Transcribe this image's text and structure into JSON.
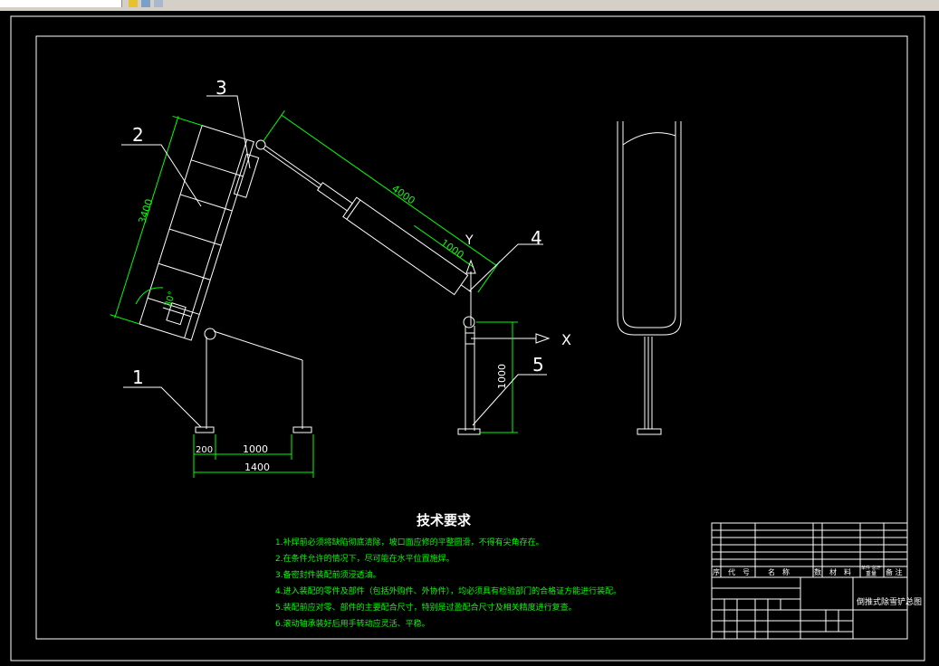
{
  "dimensions": {
    "d3400": "3400",
    "d4000": "4000",
    "d1000_cyl": "1000",
    "d30": "30°",
    "d1000_post": "1000",
    "d200": "200",
    "d1000_base": "1000",
    "d1400": "1400"
  },
  "part_labels": {
    "p1": "1",
    "p2": "2",
    "p3": "3",
    "p4": "4",
    "p5": "5"
  },
  "axes": {
    "x": "X",
    "y": "Y"
  },
  "tech": {
    "title": "技术要求",
    "items": [
      "1.补焊前必须将缺陷彻底清除，坡口面应修的平整圆滑，不得有尖角存在。",
      "2.在条件允许的情况下，尽可能在水平位置施焊。",
      "3.备密封件装配前须浸透油。",
      "4.进入装配的零件及部件（包括外购件、外协件），均必须具有检验部门的合格证方能进行装配。",
      "5.装配前应对零、部件的主要配合尺寸，特别是过盈配合尺寸及相关精度进行复查。",
      "6.滚动轴承装好后用手转动应灵活、平稳。"
    ]
  },
  "title_block": {
    "header": {
      "seq": "序",
      "code": "代　号",
      "name": "名　称",
      "qty": "数",
      "material": "材　料",
      "weight": "单件 总计",
      "mass": "重量",
      "note": "备 注"
    },
    "drawing_title": "倒推式除雪铲总图"
  }
}
